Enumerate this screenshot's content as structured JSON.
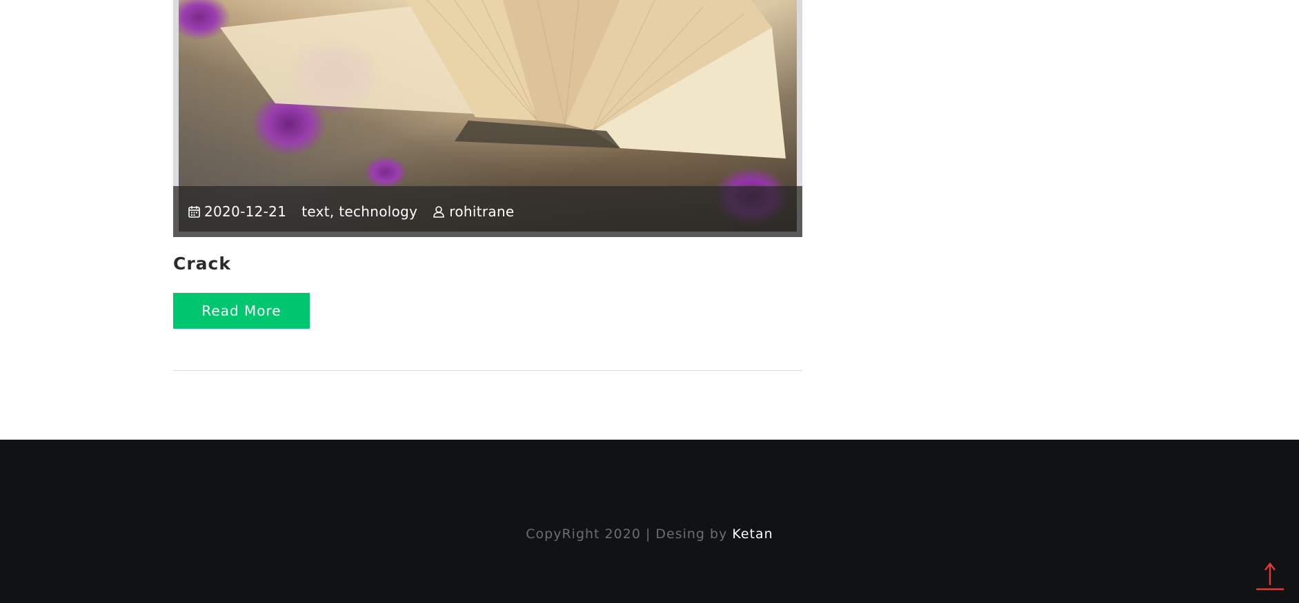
{
  "post": {
    "meta": {
      "date": "2020-12-21",
      "categories": "text, technology",
      "author": "rohitrane"
    },
    "title": "Crack",
    "read_more_label": "Read More"
  },
  "footer": {
    "copyright_prefix": "CopyRight 2020 | Desing by ",
    "author_link": "Ketan"
  },
  "icons": {
    "date": "calendar-icon",
    "author": "user-icon",
    "scroll_top": "arrow-up-icon"
  },
  "colors": {
    "accent_button": "#00c76d",
    "footer_bg": "#111214",
    "scroll_top": "#e53935"
  }
}
